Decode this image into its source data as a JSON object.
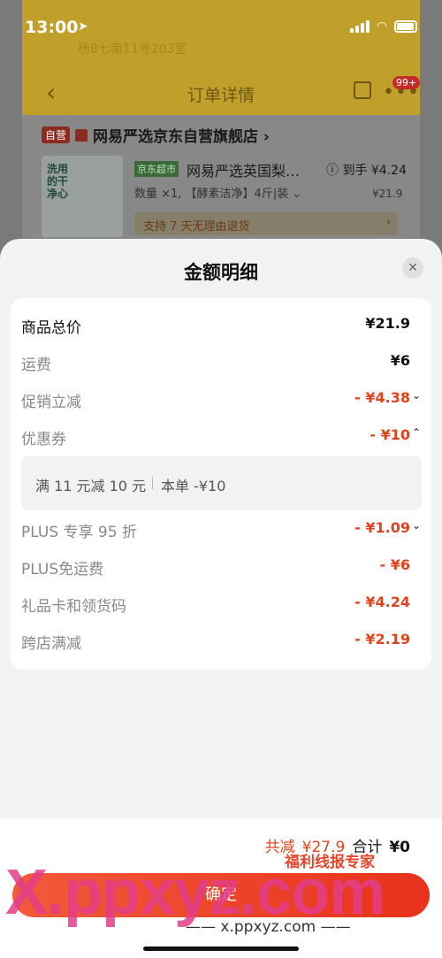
{
  "status_bar": {
    "time": "13:00",
    "location_icon": "location-arrow-icon"
  },
  "background_page": {
    "address": "杨8七南11号203室",
    "nav_title": "订单详情",
    "notification_badge": "99+",
    "store": {
      "tag_self": "自营",
      "name": "网易严选京东自营旗舰店 ›"
    },
    "product": {
      "image_text": "洗用的干净心",
      "tag": "京东超市",
      "title": "网易严选英国梨…",
      "price_label": "ⓘ 到手 ¥4.24",
      "qty_line": "数量 ×1, 【酵素洁净】4斤|装 ⌄",
      "unit_price": "¥21.9",
      "return_policy": "支持 7 天无理由退货"
    }
  },
  "sheet": {
    "title": "金额明细",
    "rows": [
      {
        "label": "商品总价",
        "value": "¥21.9"
      },
      {
        "label": "运费",
        "value": "¥6"
      },
      {
        "label": "促销立减",
        "value": "- ¥4.38"
      },
      {
        "label": "优惠券",
        "value": "- ¥10"
      },
      {
        "label": "PLUS 专享 95 折",
        "value": "- ¥1.09"
      },
      {
        "label": "PLUS免运费",
        "value": "- ¥6"
      },
      {
        "label": "礼品卡和领货码",
        "value": "- ¥4.24"
      },
      {
        "label": "跨店满减",
        "value": "- ¥2.19"
      }
    ],
    "coupon_detail": {
      "condition": "满 11 元减 10 元",
      "applied": "本单 -¥10"
    }
  },
  "footer": {
    "total_off_label": "共减",
    "total_off": "¥27.9",
    "total_label": "合计",
    "total": "¥0",
    "confirm_label": "确定"
  },
  "watermark": {
    "big": "X.ppxyz.com",
    "badge": "福利线报专家",
    "small": "—— x.ppxyz.com ——"
  },
  "colors": {
    "accent": "#e0441c",
    "button": "#ee3f22"
  }
}
